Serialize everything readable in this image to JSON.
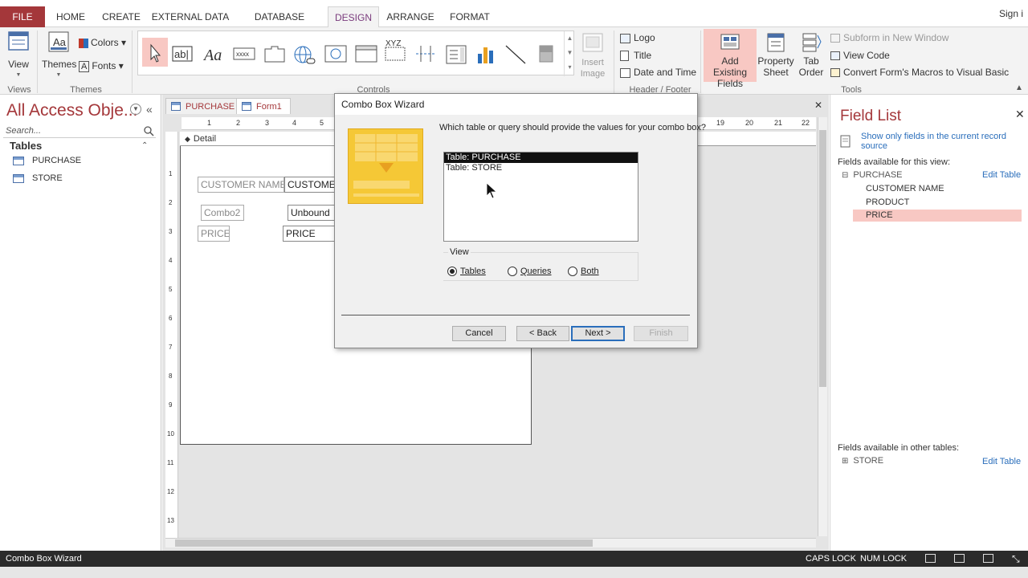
{
  "ribbon_tabs": [
    "FILE",
    "HOME",
    "CREATE",
    "EXTERNAL DATA",
    "DATABASE TOOLS",
    "DESIGN",
    "ARRANGE",
    "FORMAT"
  ],
  "signin": "Sign i",
  "ribbon": {
    "view_label": "View",
    "themes_label": "Themes",
    "colors_label": "Colors",
    "fonts_label": "Fonts",
    "insert_image_label": "Insert Image",
    "logo_label": "Logo",
    "title_label": "Title",
    "date_time_label": "Date and Time",
    "add_existing_fields_label": "Add Existing Fields",
    "property_sheet_label": "Property Sheet",
    "tab_order_label": "Tab Order",
    "subform_label": "Subform in New Window",
    "view_code_label": "View Code",
    "convert_macros_label": "Convert Form's Macros to Visual Basic",
    "groups": {
      "views": "Views",
      "themes": "Themes",
      "controls": "Controls",
      "header_footer": "Header / Footer",
      "tools": "Tools"
    }
  },
  "nav": {
    "title": "All Access Obje...",
    "search_placeholder": "Search...",
    "section": "Tables",
    "items": [
      "PURCHASE",
      "STORE"
    ]
  },
  "doc": {
    "tabs": [
      "PURCHASE",
      "Form1"
    ],
    "detail_label": "Detail",
    "ruler_ticks": [
      "1",
      "2",
      "3",
      "4",
      "5",
      "19",
      "20",
      "21",
      "22"
    ],
    "vruler_ticks": [
      "1",
      "2",
      "3",
      "4",
      "5",
      "6",
      "7",
      "8",
      "9",
      "10",
      "11",
      "12",
      "13"
    ],
    "controls": {
      "customer_name_label": "CUSTOMER NAME",
      "customer_name_field": "CUSTOMER",
      "combo2_label": "Combo2",
      "unbound_field": "Unbound",
      "price_label": "PRICE",
      "price_field": "PRICE"
    }
  },
  "field_list": {
    "title": "Field List",
    "show_only": "Show only fields in the current record source",
    "available_for_view": "Fields available for this view:",
    "table_name": "PURCHASE",
    "edit_table": "Edit Table",
    "fields": [
      "CUSTOMER NAME",
      "PRODUCT",
      "PRICE"
    ],
    "available_other": "Fields available in other tables:",
    "other_table": "STORE",
    "edit_table_2": "Edit Table"
  },
  "dialog": {
    "title": "Combo Box Wizard",
    "question": "Which table or query should provide the values for your combo box?",
    "list_items": [
      "Table: PURCHASE",
      "Table: STORE"
    ],
    "view_group": "View",
    "radio_tables": "Tables",
    "radio_queries": "Queries",
    "radio_both": "Both",
    "cancel": "Cancel",
    "back": "< Back",
    "next": "Next >",
    "finish": "Finish"
  },
  "status": {
    "left": "Combo Box Wizard",
    "caps": "CAPS LOCK",
    "num": "NUM LOCK"
  },
  "colors": {
    "accent": "#a4373a",
    "design_tab": "#7a3b7d",
    "selection_highlight": "#f8c8c3"
  }
}
